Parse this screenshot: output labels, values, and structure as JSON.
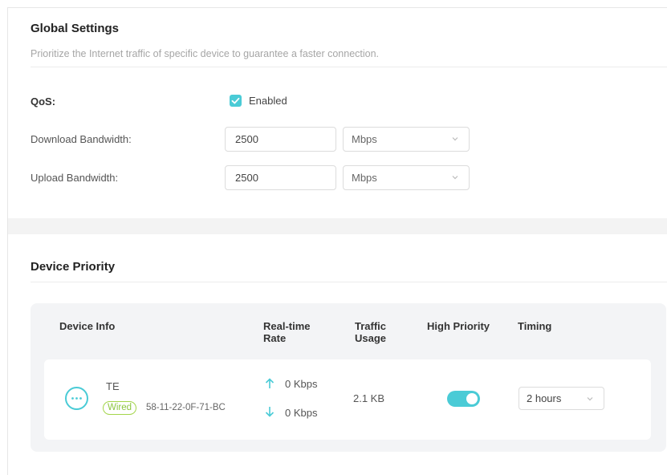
{
  "global_settings": {
    "title": "Global Settings",
    "subtitle": "Prioritize the Internet traffic of specific device to guarantee a faster connection.",
    "qos": {
      "label": "QoS:",
      "checkbox_label": "Enabled",
      "checked": true
    },
    "download": {
      "label": "Download Bandwidth:",
      "value": "2500",
      "unit": "Mbps"
    },
    "upload": {
      "label": "Upload Bandwidth:",
      "value": "2500",
      "unit": "Mbps"
    }
  },
  "device_priority": {
    "title": "Device Priority",
    "columns": {
      "device_info": "Device Info",
      "realtime_rate_1": "Real-time",
      "realtime_rate_2": "Rate",
      "traffic_usage_1": "Traffic",
      "traffic_usage_2": "Usage",
      "high_priority": "High Priority",
      "timing": "Timing"
    },
    "devices": [
      {
        "name": "TE",
        "connection": "Wired",
        "mac": "58-11-22-0F-71-BC",
        "upload_rate": "0 Kbps",
        "download_rate": "0 Kbps",
        "traffic_usage": "2.1 KB",
        "high_priority": true,
        "timing": "2 hours"
      }
    ]
  },
  "colors": {
    "accent": "#4acbd6",
    "wired_tag": "#8cc63f",
    "panel_bg": "#f3f4f6"
  },
  "icons": {
    "checkbox": "check-icon",
    "dropdown": "chevron-down-icon",
    "device": "more-dots-icon",
    "up": "arrow-up-icon",
    "down": "arrow-down-icon"
  }
}
